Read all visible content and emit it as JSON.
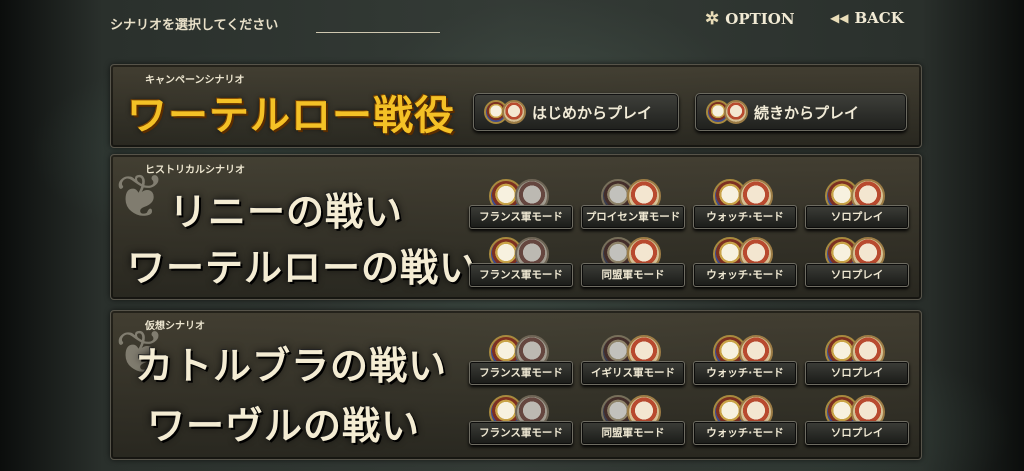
{
  "header": {
    "title": "シナリオを選択してください",
    "option_label": "OPTION",
    "back_label": "BACK"
  },
  "campaign": {
    "category": "キャンペーンシナリオ",
    "title": "ワーテルロー戦役",
    "start_label": "はじめからプレイ",
    "continue_label": "続きからプレイ"
  },
  "historical": {
    "category": "ヒストリカルシナリオ",
    "scenarios": [
      {
        "title": "リニーの戦い",
        "modes": [
          "フランス軍モード",
          "プロイセン軍モード",
          "ウォッチ·モード",
          "ソロプレイ"
        ]
      },
      {
        "title": "ワーテルローの戦い",
        "modes": [
          "フランス軍モード",
          "同盟軍モード",
          "ウォッチ·モード",
          "ソロプレイ"
        ]
      }
    ]
  },
  "hypothetical": {
    "category": "仮想シナリオ",
    "scenarios": [
      {
        "title": "カトルブラの戦い",
        "modes": [
          "フランス軍モード",
          "イギリス軍モード",
          "ウォッチ·モード",
          "ソロプレイ"
        ]
      },
      {
        "title": "ワーヴルの戦い",
        "modes": [
          "フランス軍モード",
          "同盟軍モード",
          "ウォッチ·モード",
          "ソロプレイ"
        ]
      }
    ]
  },
  "colors": {
    "title_gold": "#f4c126",
    "title_cream": "#f4ecd3",
    "button_text": "#efe8d2"
  },
  "icons": {
    "option": "gear-icon",
    "back": "rewind-icon",
    "french_emblem": "french-army-emblem-icon",
    "allied_emblem": "allied-army-emblem-icon"
  }
}
